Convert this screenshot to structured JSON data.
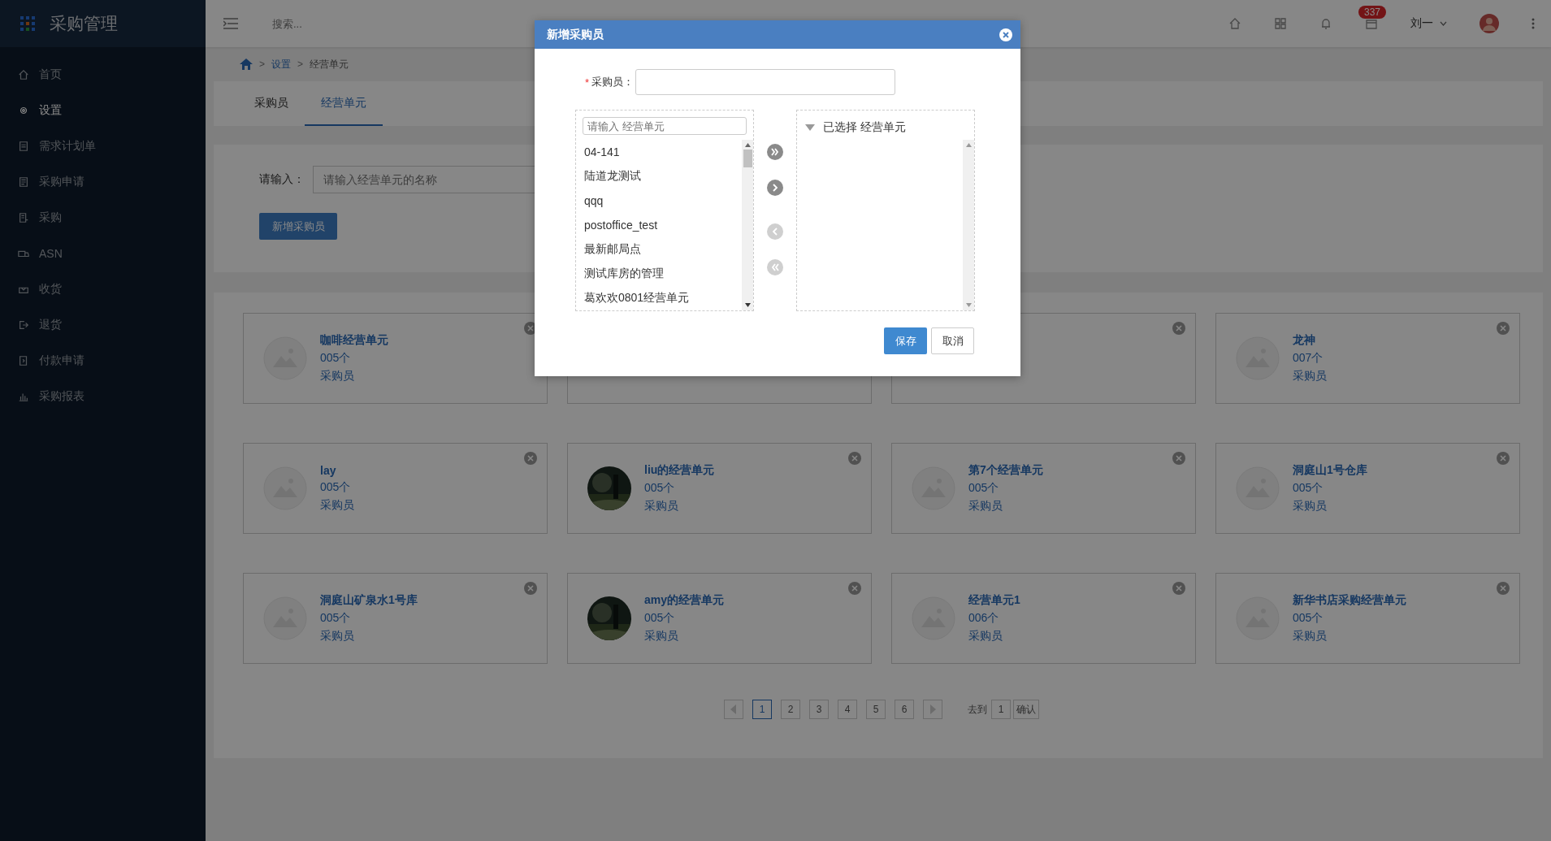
{
  "sidebar": {
    "title": "采购管理",
    "items": [
      {
        "label": "首页",
        "selected": false
      },
      {
        "label": "设置",
        "selected": true
      },
      {
        "label": "需求计划单",
        "selected": false
      },
      {
        "label": "采购申请",
        "selected": false
      },
      {
        "label": "采购",
        "selected": false
      },
      {
        "label": "ASN",
        "selected": false
      },
      {
        "label": "收货",
        "selected": false
      },
      {
        "label": "退货",
        "selected": false
      },
      {
        "label": "付款申请",
        "selected": false
      },
      {
        "label": "采购报表",
        "selected": false
      }
    ]
  },
  "header": {
    "search": {
      "placeholder": "搜索..."
    },
    "badge": "337",
    "user": "刘一"
  },
  "breadcrumb": [
    {
      "separator": ">",
      "label": "设置",
      "kind": "link"
    },
    {
      "separator": ">",
      "label": "经营单元",
      "kind": "current"
    }
  ],
  "tabs": [
    {
      "label": "采购员",
      "selected": false
    },
    {
      "label": "经营单元",
      "selected": true
    }
  ],
  "filter": {
    "label": "请输入：",
    "placeholder": "请输入经营单元的名称",
    "button": "新增采购员"
  },
  "cards": [
    {
      "kind": "placeholder",
      "title": "咖啡经营单元",
      "count": "005个",
      "role": "采购员"
    },
    {
      "kind": "covered"
    },
    {
      "kind": "covered",
      "close": true
    },
    {
      "kind": "placeholder",
      "title": "龙神",
      "count": "007个",
      "role": "采购员"
    },
    {
      "kind": "placeholder",
      "title": "lay",
      "count": "005个",
      "role": "采购员"
    },
    {
      "kind": "picture",
      "title": "liu的经营单元",
      "count": "005个",
      "role": "采购员"
    },
    {
      "kind": "placeholder",
      "title": "第7个经营单元",
      "count": "005个",
      "role": "采购员"
    },
    {
      "kind": "placeholder",
      "title": "洞庭山1号仓库",
      "count": "005个",
      "role": "采购员"
    },
    {
      "kind": "placeholder",
      "title": "洞庭山矿泉水1号库",
      "count": "005个",
      "role": "采购员"
    },
    {
      "kind": "picture",
      "title": "amy的经营单元",
      "count": "005个",
      "role": "采购员"
    },
    {
      "kind": "placeholder",
      "title": "经营单元1",
      "count": "006个",
      "role": "采购员"
    },
    {
      "kind": "placeholder",
      "title": "新华书店采购经营单元",
      "count": "005个",
      "role": "采购员"
    }
  ],
  "pagination": {
    "pages": [
      {
        "label": "1",
        "selected": true
      },
      {
        "label": "2",
        "selected": false
      },
      {
        "label": "3",
        "selected": false
      },
      {
        "label": "4",
        "selected": false
      },
      {
        "label": "5",
        "selected": false
      },
      {
        "label": "6",
        "selected": false
      }
    ],
    "goto_label": "去到",
    "goto_value": "1",
    "confirm": "确认"
  },
  "modal": {
    "title": "新增采购员",
    "required_mark": "*",
    "field_label": "采购员：",
    "source": {
      "placeholder": "请输入 经营单元",
      "items": [
        "04-141",
        "陆道龙测试",
        "qqq",
        "postoffice_test",
        "最新邮局点",
        "测试库房的管理",
        "葛欢欢0801经营单元"
      ]
    },
    "transfer": [
      {
        "kind": "all-right",
        "disabled": false
      },
      {
        "kind": "right",
        "disabled": false
      },
      {
        "kind": "left",
        "disabled": true
      },
      {
        "kind": "all-left",
        "disabled": true
      }
    ],
    "target": {
      "title": "已选择 经营单元"
    },
    "buttons": [
      {
        "label": "保存",
        "kind": "primary"
      },
      {
        "label": "取消",
        "kind": "default"
      }
    ]
  }
}
